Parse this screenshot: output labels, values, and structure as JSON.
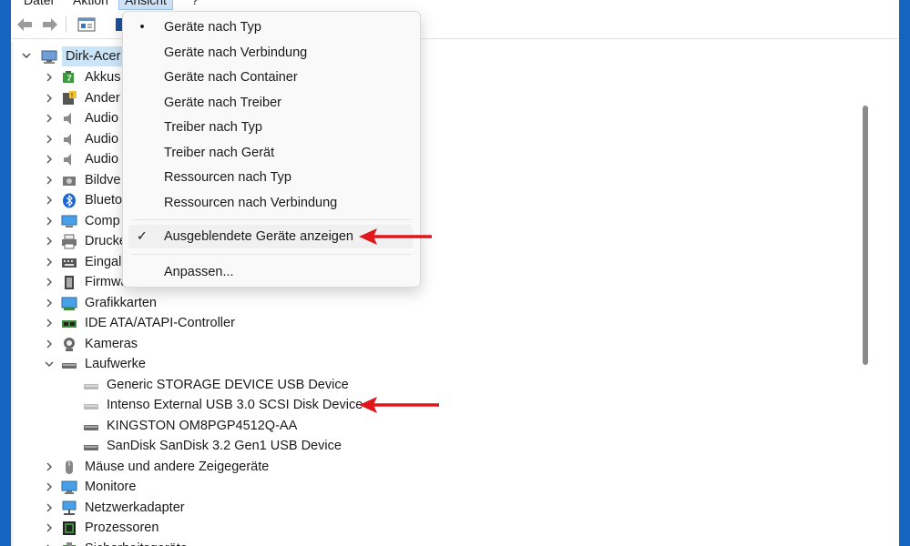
{
  "menubar": {
    "items": [
      {
        "label": "Datei"
      },
      {
        "label": "Aktion"
      },
      {
        "label": "Ansicht"
      },
      {
        "label": "?"
      }
    ]
  },
  "toolbar": {
    "icons": [
      "back-arrow-icon",
      "forward-arrow-icon",
      "properties-icon",
      "help-icon"
    ]
  },
  "tree": {
    "root": "Dirk-Acer",
    "nodes": [
      {
        "label": "Akkus",
        "icon": "battery-icon"
      },
      {
        "label": "Andere Geräte",
        "visible": "Ander",
        "icon": "unknown-device-icon"
      },
      {
        "label": "Audio",
        "icon": "speaker-icon"
      },
      {
        "label": "Audio",
        "icon": "speaker-icon"
      },
      {
        "label": "Audio",
        "icon": "speaker-icon"
      },
      {
        "label": "Bildve",
        "icon": "camera-device-icon"
      },
      {
        "label": "Blueto",
        "icon": "bluetooth-icon"
      },
      {
        "label": "Comp",
        "icon": "computer-icon"
      },
      {
        "label": "Drucke",
        "icon": "printer-icon"
      },
      {
        "label": "Eingal",
        "icon": "keyboard-icon"
      },
      {
        "label": "Firmware",
        "icon": "firmware-chip-icon"
      },
      {
        "label": "Grafikkarten",
        "icon": "display-adapter-icon"
      },
      {
        "label": "IDE ATA/ATAPI-Controller",
        "icon": "ide-controller-icon"
      },
      {
        "label": "Kameras",
        "icon": "webcam-icon"
      },
      {
        "label": "Laufwerke",
        "icon": "drive-icon"
      }
    ],
    "drives": [
      {
        "label": "Generic STORAGE DEVICE USB Device",
        "hidden": true
      },
      {
        "label": "Intenso External USB 3.0 SCSI Disk Device",
        "hidden": true
      },
      {
        "label": "KINGSTON OM8PGP4512Q-AA",
        "hidden": false
      },
      {
        "label": "SanDisk SanDisk 3.2 Gen1 USB Device",
        "hidden": false
      }
    ],
    "after": [
      {
        "label": "Mäuse und andere Zeigegeräte",
        "icon": "mouse-icon"
      },
      {
        "label": "Monitore",
        "icon": "monitor-icon"
      },
      {
        "label": "Netzwerkadapter",
        "icon": "network-adapter-icon"
      },
      {
        "label": "Prozessoren",
        "icon": "processor-icon"
      },
      {
        "label": "Sicherheitsgeräte",
        "icon": "security-device-icon"
      }
    ]
  },
  "view_menu": {
    "items": [
      {
        "label": "Geräte nach Typ",
        "mark": "•"
      },
      {
        "label": "Geräte nach Verbindung",
        "mark": ""
      },
      {
        "label": "Geräte nach Container",
        "mark": ""
      },
      {
        "label": "Geräte nach Treiber",
        "mark": ""
      },
      {
        "label": "Treiber nach Typ",
        "mark": ""
      },
      {
        "label": "Treiber nach Gerät",
        "mark": ""
      },
      {
        "label": "Ressourcen nach Typ",
        "mark": ""
      },
      {
        "label": "Ressourcen nach Verbindung",
        "mark": ""
      }
    ],
    "show_hidden": {
      "label": "Ausgeblendete Geräte anzeigen",
      "mark": "✓"
    },
    "customize": {
      "label": "Anpassen..."
    }
  },
  "colors": {
    "background": "#1565c0",
    "annotation_arrow": "#e0161b",
    "selection": "#cce4f7"
  }
}
